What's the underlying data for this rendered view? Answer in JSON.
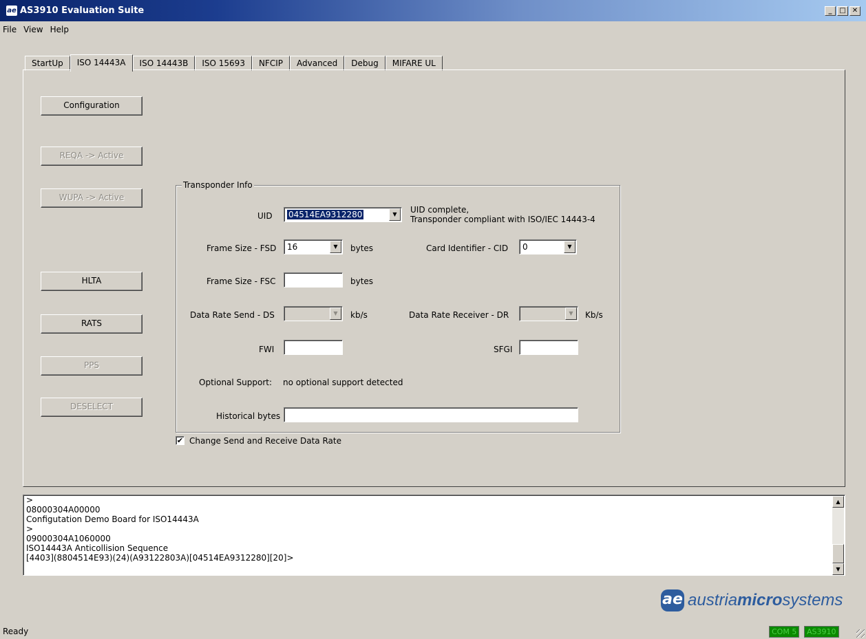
{
  "window": {
    "title": "AS3910 Evaluation Suite",
    "icon_text": "ae",
    "minimize_glyph": "_",
    "maximize_glyph": "□",
    "close_glyph": "✕"
  },
  "menu": [
    "File",
    "View",
    "Help"
  ],
  "tabs": [
    "StartUp",
    "ISO 14443A",
    "ISO 14443B",
    "ISO 15693",
    "NFCIP",
    "Advanced",
    "Debug",
    "MIFARE UL"
  ],
  "active_tab": "ISO 14443A",
  "buttons": {
    "configuration": "Configuration",
    "reqa": "REQA -> Active",
    "wupa": "WUPA -> Active",
    "hlta": "HLTA",
    "rats": "RATS",
    "pps": "PPS",
    "deselect": "DESELECT"
  },
  "transponder": {
    "legend": "Transponder Info",
    "uid_label": "UID",
    "uid_value": "04514EA9312280",
    "uid_status_1": "UID complete,",
    "uid_status_2": "Transponder compliant with ISO/IEC 14443-4",
    "fsd_label": "Frame Size - FSD",
    "fsd_value": "16",
    "bytes_unit": "bytes",
    "cid_label": "Card Identifier - CID",
    "cid_value": "0",
    "fsc_label": "Frame Size - FSC",
    "fsc_value": "",
    "ds_label": "Data Rate Send - DS",
    "ds_unit": "kb/s",
    "dr_label": "Data Rate Receiver - DR",
    "dr_unit": "Kb/s",
    "fwi_label": "FWI",
    "fwi_value": "",
    "sfgi_label": "SFGI",
    "sfgi_value": "",
    "optional_label": "Optional Support:",
    "optional_value": "no optional support detected",
    "historical_label": "Historical bytes",
    "historical_value": ""
  },
  "checkbox": {
    "label": "Change Send and Receive Data Rate",
    "checked": true,
    "glyph": "✔"
  },
  "console_lines": [
    ">",
    "08000304A00000",
    "Configutation Demo Board for ISO14443A",
    ">",
    "09000304A1060000",
    "ISO14443A Anticollision Sequence",
    "[4403](8804514E93)(24)(A93122803A)[04514EA9312280][20]>"
  ],
  "logo": {
    "mark": "ae",
    "text_1": "austria",
    "text_2": "micro",
    "text_3": "systems"
  },
  "status": {
    "text": "Ready",
    "port": "COM 5",
    "device": "AS3910"
  }
}
